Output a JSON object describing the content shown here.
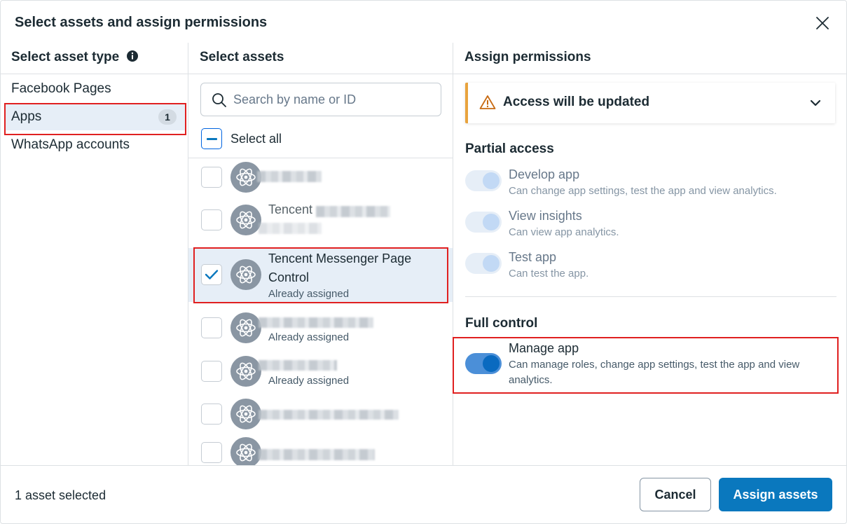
{
  "dialog": {
    "title": "Select assets and assign permissions"
  },
  "asset_type": {
    "header": "Select asset type",
    "items": [
      {
        "label": "Facebook Pages"
      },
      {
        "label": "Apps",
        "badge": "1"
      },
      {
        "label": "WhatsApp accounts"
      }
    ]
  },
  "assets": {
    "header": "Select assets",
    "search_placeholder": "Search by name or ID",
    "select_all_label": "Select all",
    "items": [
      {
        "name": "",
        "sub": ""
      },
      {
        "name": "Tencent",
        "sub": ""
      },
      {
        "name": "Tencent Messenger Page Control",
        "sub": "Already assigned",
        "checked": true
      },
      {
        "name": "",
        "sub": "Already assigned"
      },
      {
        "name": "",
        "sub": "Already assigned"
      },
      {
        "name": "",
        "sub": ""
      },
      {
        "name": "",
        "sub": ""
      }
    ]
  },
  "permissions": {
    "header": "Assign permissions",
    "notice": "Access will be updated",
    "partial_title": "Partial access",
    "partial": [
      {
        "label": "Develop app",
        "desc": "Can change app settings, test the app and view analytics."
      },
      {
        "label": "View insights",
        "desc": "Can view app analytics."
      },
      {
        "label": "Test app",
        "desc": "Can test the app."
      }
    ],
    "full_title": "Full control",
    "full": [
      {
        "label": "Manage app",
        "desc": "Can manage roles, change app settings, test the app and view analytics.",
        "on": true
      }
    ]
  },
  "footer": {
    "count_text": "1 asset selected",
    "cancel_label": "Cancel",
    "assign_label": "Assign assets"
  },
  "colors": {
    "primary": "#0a78be",
    "selected_bg": "#e6eef7",
    "warning": "#e8a33d",
    "highlight": "#e02020"
  }
}
